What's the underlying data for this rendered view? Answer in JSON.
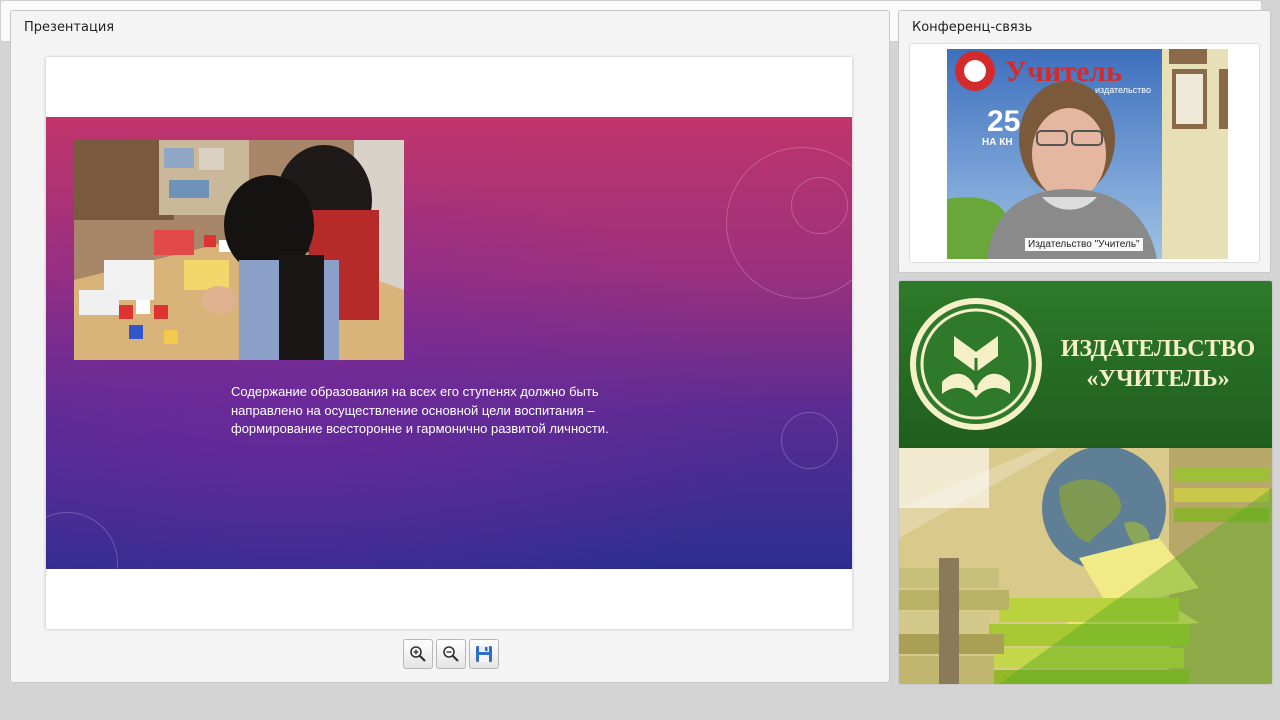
{
  "presentation": {
    "title": "Презентация",
    "slide_text": "Содержание образования на всех его ступенях должно быть направлено на осуществление основной цели воспитания – формирование всесторонне и гармонично развитой личности.",
    "toolbar": {
      "zoom_in_icon": "zoom-in-icon",
      "zoom_out_icon": "zoom-out-icon",
      "save_icon": "floppy-disk-icon"
    }
  },
  "conference": {
    "title": "Конференц-связь",
    "participant_label": "Издательство \"Учитель\"",
    "background_sign": "Учитель",
    "background_sign_sub": "издательство",
    "background_number": "25",
    "background_number_sub": "НА КН"
  },
  "logo_panel": {
    "line1": "ИЗДАТЕЛЬСТВО",
    "line2": "«УЧИТЕЛЬ»",
    "colors": {
      "green": "#2e7a2a",
      "cream": "#f5f0c8"
    }
  }
}
